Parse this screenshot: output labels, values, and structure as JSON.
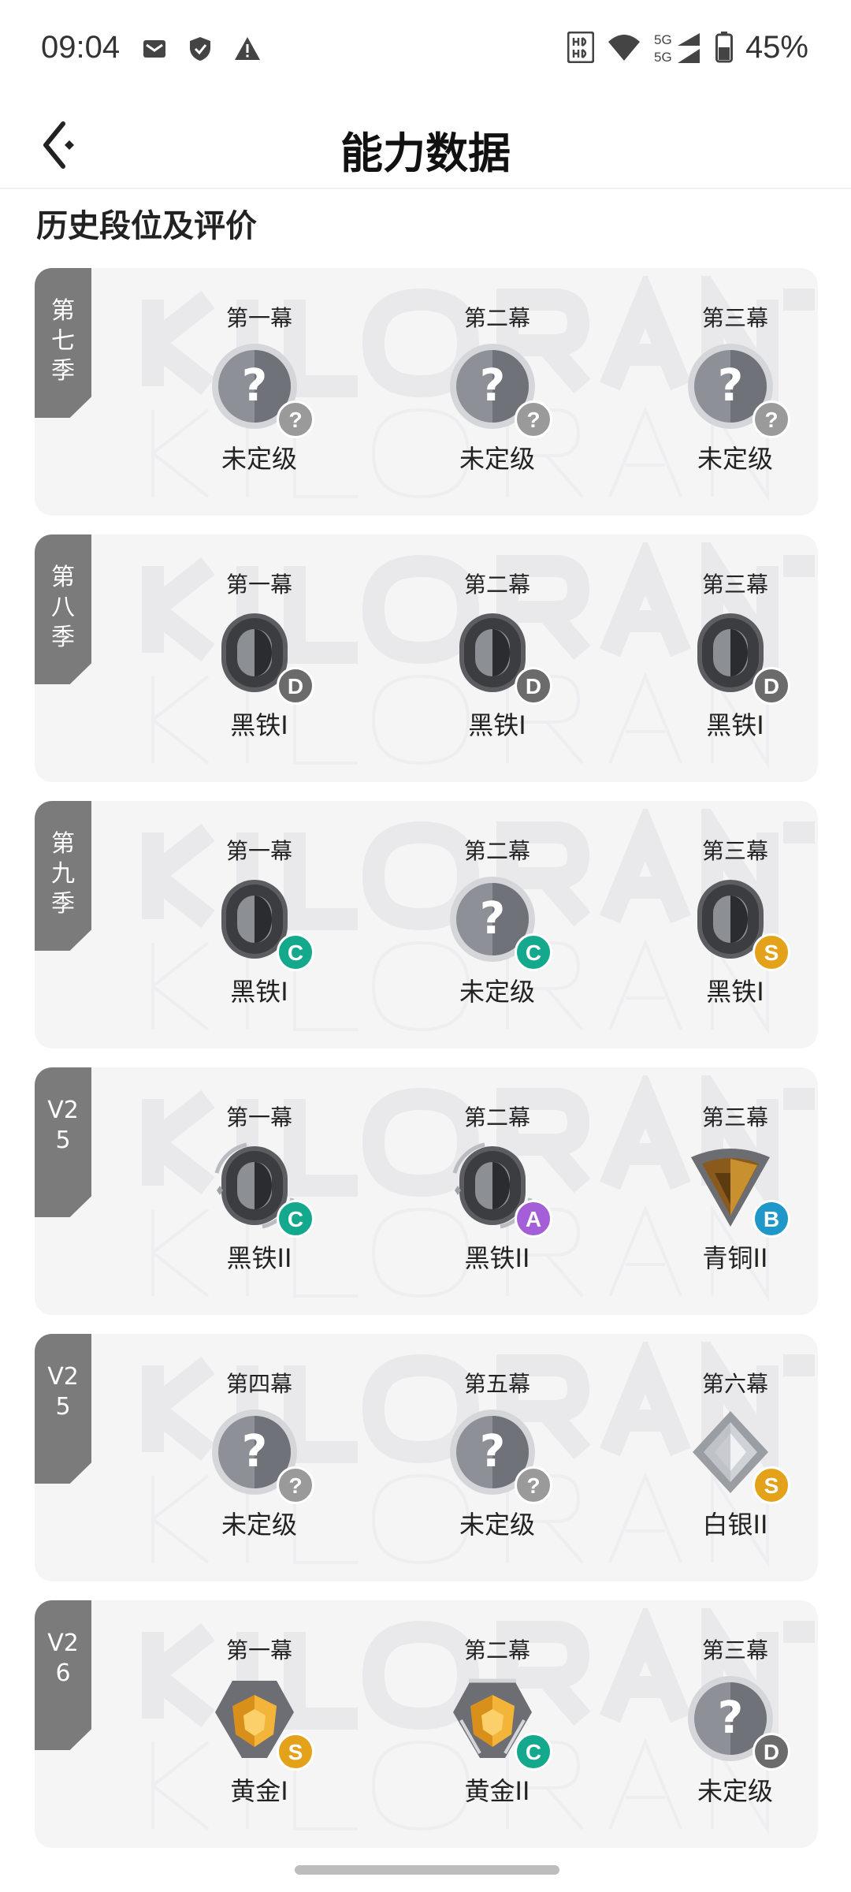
{
  "status_bar": {
    "time": "09:04",
    "battery": "45%",
    "icons": [
      "mail-icon",
      "shield-icon",
      "warning-icon",
      "hd-icon",
      "wifi-icon",
      "signal-5g-icon",
      "battery-icon"
    ]
  },
  "header": {
    "title": "能力数据",
    "back_icon": "back-arrow-icon"
  },
  "section": {
    "title": "历史段位及评价"
  },
  "seasons": [
    {
      "tag": "第七季",
      "acts": [
        {
          "act": "第一幕",
          "rank": "未定级",
          "emblem": "unranked",
          "grade": "?",
          "grade_color": "#9a9a9a"
        },
        {
          "act": "第二幕",
          "rank": "未定级",
          "emblem": "unranked",
          "grade": "?",
          "grade_color": "#9a9a9a"
        },
        {
          "act": "第三幕",
          "rank": "未定级",
          "emblem": "unranked",
          "grade": "?",
          "grade_color": "#9a9a9a"
        }
      ]
    },
    {
      "tag": "第八季",
      "acts": [
        {
          "act": "第一幕",
          "rank": "黑铁I",
          "emblem": "iron",
          "grade": "D",
          "grade_color": "#6b6b6b"
        },
        {
          "act": "第二幕",
          "rank": "黑铁I",
          "emblem": "iron",
          "grade": "D",
          "grade_color": "#6b6b6b"
        },
        {
          "act": "第三幕",
          "rank": "黑铁I",
          "emblem": "iron",
          "grade": "D",
          "grade_color": "#6b6b6b"
        }
      ]
    },
    {
      "tag": "第九季",
      "acts": [
        {
          "act": "第一幕",
          "rank": "黑铁I",
          "emblem": "iron",
          "grade": "C",
          "grade_color": "#14a88c"
        },
        {
          "act": "第二幕",
          "rank": "未定级",
          "emblem": "unranked",
          "grade": "C",
          "grade_color": "#14a88c"
        },
        {
          "act": "第三幕",
          "rank": "黑铁I",
          "emblem": "iron",
          "grade": "S",
          "grade_color": "#e3a21a"
        }
      ]
    },
    {
      "tag": "V25",
      "acts": [
        {
          "act": "第一幕",
          "rank": "黑铁II",
          "emblem": "iron2",
          "grade": "C",
          "grade_color": "#14a88c"
        },
        {
          "act": "第二幕",
          "rank": "黑铁II",
          "emblem": "iron2",
          "grade": "A",
          "grade_color": "#a45fd8"
        },
        {
          "act": "第三幕",
          "rank": "青铜II",
          "emblem": "bronze",
          "grade": "B",
          "grade_color": "#1f97c9"
        }
      ]
    },
    {
      "tag": "V25",
      "acts": [
        {
          "act": "第四幕",
          "rank": "未定级",
          "emblem": "unranked",
          "grade": "?",
          "grade_color": "#9a9a9a"
        },
        {
          "act": "第五幕",
          "rank": "未定级",
          "emblem": "unranked",
          "grade": "?",
          "grade_color": "#9a9a9a"
        },
        {
          "act": "第六幕",
          "rank": "白银II",
          "emblem": "silver",
          "grade": "S",
          "grade_color": "#e3a21a"
        }
      ]
    },
    {
      "tag": "V26",
      "acts": [
        {
          "act": "第一幕",
          "rank": "黄金I",
          "emblem": "gold",
          "grade": "S",
          "grade_color": "#e3a21a"
        },
        {
          "act": "第二幕",
          "rank": "黄金II",
          "emblem": "gold2",
          "grade": "C",
          "grade_color": "#14a88c"
        },
        {
          "act": "第三幕",
          "rank": "未定级",
          "emblem": "unranked",
          "grade": "D",
          "grade_color": "#6b6b6b"
        }
      ]
    }
  ]
}
